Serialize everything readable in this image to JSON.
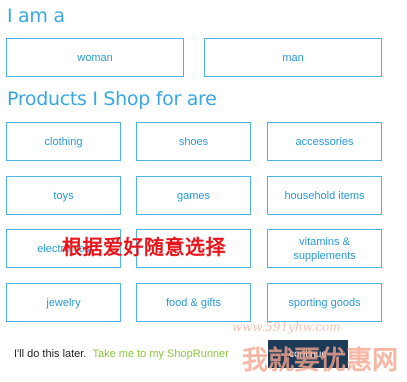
{
  "gender": {
    "heading": "I am a",
    "options": [
      {
        "label": "woman"
      },
      {
        "label": "man"
      }
    ]
  },
  "products": {
    "heading": "Products I Shop for are",
    "options": [
      {
        "label": "clothing"
      },
      {
        "label": "shoes"
      },
      {
        "label": "accessories"
      },
      {
        "label": "toys"
      },
      {
        "label": "games"
      },
      {
        "label": "household items"
      },
      {
        "label": "electronics"
      },
      {
        "label": ""
      },
      {
        "label": "vitamins & supplements"
      },
      {
        "label": "jewelry"
      },
      {
        "label": "food & gifts"
      },
      {
        "label": "sporting goods"
      }
    ]
  },
  "overlay_text": "根据爱好随意选择",
  "footer": {
    "later": "I'll do this later.",
    "take_me": "Take me to my ShopRunner",
    "continue_label": "continue"
  },
  "watermark": {
    "url": "www.591yhw.com",
    "logo_text": "我就要优惠网"
  },
  "colors": {
    "accent": "#3aa8df",
    "border": "#4fb3e5",
    "overlay": "#e8151b",
    "link_green": "#8cc63f",
    "button_navy": "#1d3a57"
  }
}
